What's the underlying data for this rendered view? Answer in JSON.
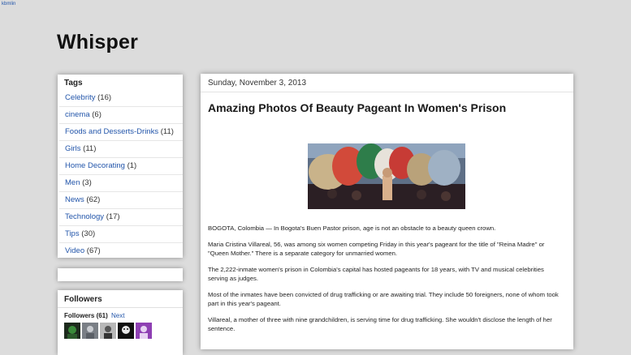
{
  "topbar": {
    "text": "kbmlin"
  },
  "blog": {
    "title": "Whisper"
  },
  "sidebar": {
    "tags": {
      "heading": "Tags",
      "items": [
        {
          "label": "Celebrity",
          "count": "(16)"
        },
        {
          "label": "cinema",
          "count": "(6)"
        },
        {
          "label": "Foods and Desserts-Drinks",
          "count": "(11)"
        },
        {
          "label": "Girls",
          "count": "(11)"
        },
        {
          "label": "Home Decorating",
          "count": "(1)"
        },
        {
          "label": "Men",
          "count": "(3)"
        },
        {
          "label": "News",
          "count": "(62)"
        },
        {
          "label": "Technology",
          "count": "(17)"
        },
        {
          "label": "Tips",
          "count": "(30)"
        },
        {
          "label": "Video",
          "count": "(67)"
        }
      ]
    },
    "followers": {
      "heading": "Followers",
      "label": "Followers (61)",
      "next": "Next"
    }
  },
  "post": {
    "date": "Sunday, November 3, 2013",
    "title": "Amazing Photos Of Beauty Pageant In Women's Prison",
    "paragraphs": [
      "BOGOTA, Colombia — In Bogota's Buen Pastor prison, age is not an obstacle to a beauty queen crown.",
      "Maria Cristina Villareal, 56, was among six women competing Friday in this year's pageant for the title of \"Reina Madre\" or \"Queen Mother.\" There is a separate category for unmarried women.",
      "The 2,222-inmate women's prison in Colombia's capital has hosted pageants for 18 years, with TV and musical celebrities serving as judges.",
      "Most of the inmates have been convicted of drug trafficking or are awaiting trial. They include 50 foreigners, none of whom took part in this year's pageant.",
      "Villareal, a mother of three with nine grandchildren, is serving time for drug trafficking. She wouldn't disclose the length of her sentence."
    ]
  },
  "colors": {
    "link": "#2255aa",
    "background": "#dcdcdc",
    "panel": "#ffffff"
  }
}
